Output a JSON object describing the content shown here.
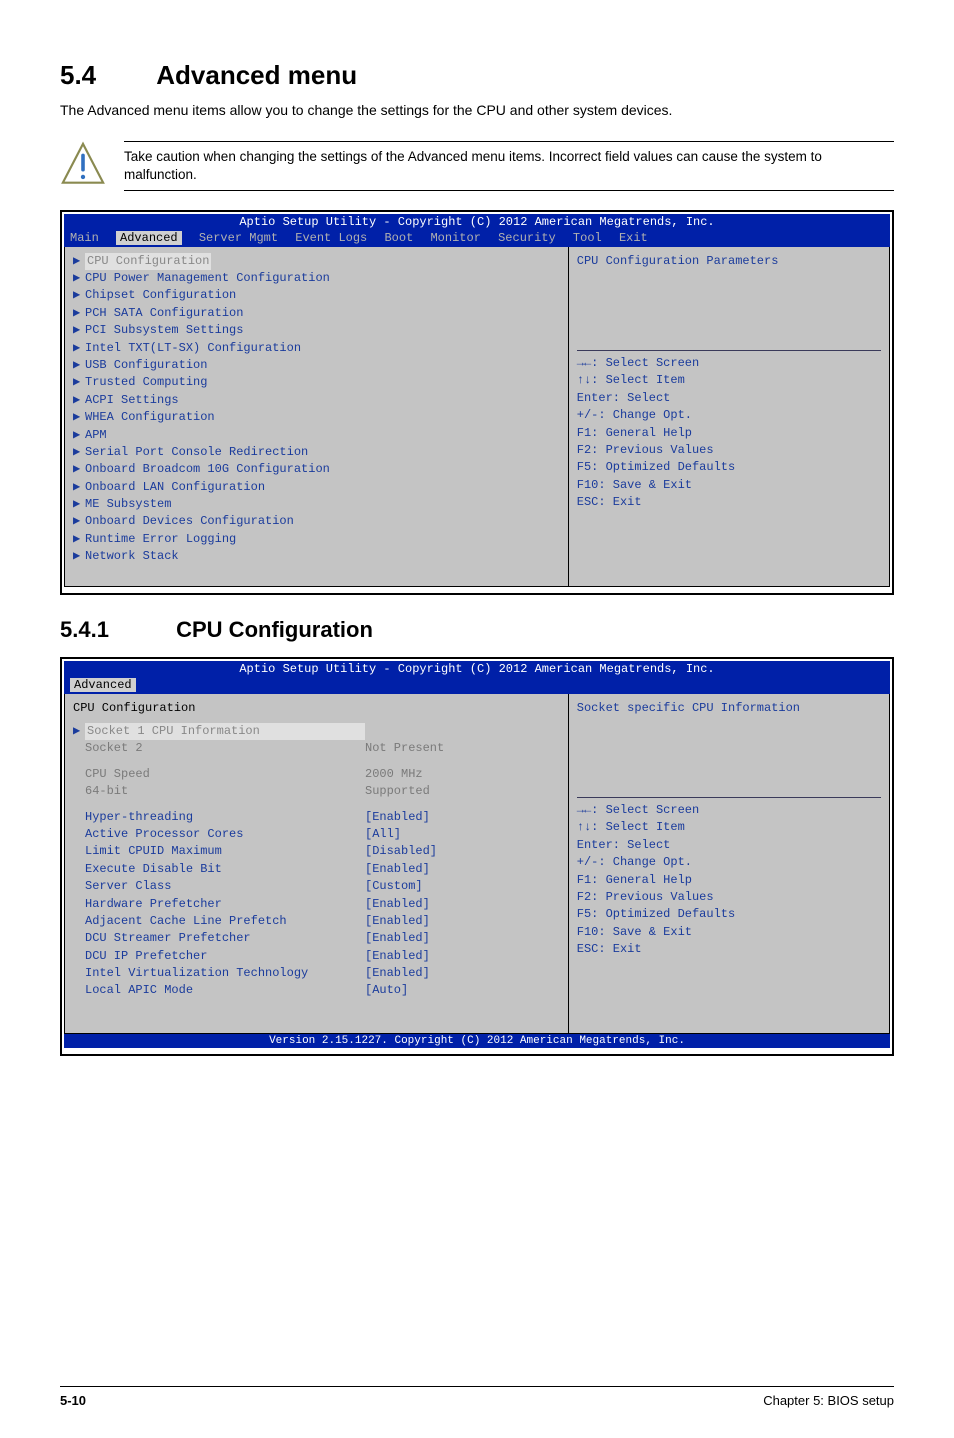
{
  "section": {
    "number": "5.4",
    "title": "Advanced menu",
    "intro": "The Advanced menu items allow you to change the settings for the CPU and other system devices.",
    "note": "Take caution when changing the settings of the Advanced menu items. Incorrect field values can cause the system to malfunction."
  },
  "subsection": {
    "number": "5.4.1",
    "title": "CPU Configuration"
  },
  "bios1": {
    "title": "Aptio Setup Utility - Copyright (C) 2012 American Megatrends, Inc.",
    "tabs": [
      "Main",
      "Advanced",
      "Server Mgmt",
      "Event Logs",
      "Boot",
      "Monitor",
      "Security",
      "Tool",
      "Exit"
    ],
    "active_tab": "Advanced",
    "items": [
      "CPU Configuration",
      "CPU Power Management Configuration",
      "Chipset Configuration",
      "PCH SATA Configuration",
      "PCI Subsystem Settings",
      "Intel TXT(LT-SX) Configuration",
      "USB Configuration",
      "Trusted Computing",
      "ACPI Settings",
      "WHEA Configuration",
      "APM",
      "Serial Port Console Redirection",
      "Onboard Broadcom 10G Configuration",
      "Onboard LAN Configuration",
      "ME Subsystem",
      "Onboard Devices Configuration",
      "Runtime Error Logging",
      "Network Stack"
    ],
    "right_header": "CPU Configuration Parameters",
    "keys": [
      "→←: Select Screen",
      "↑↓: Select Item",
      "Enter: Select",
      "+/-: Change Opt.",
      "F1: General Help",
      "F2: Previous Values",
      "F5: Optimized Defaults",
      "F10: Save & Exit",
      "ESC: Exit"
    ]
  },
  "bios2": {
    "title": "Aptio Setup Utility - Copyright (C) 2012 American Megatrends, Inc.",
    "tabs": [
      "Advanced"
    ],
    "header": "CPU Configuration",
    "dim_items": [
      {
        "label": "Socket 1 CPU Information",
        "value": ""
      },
      {
        "label": "Socket 2",
        "value": "Not Present"
      },
      {
        "label": "",
        "value": ""
      },
      {
        "label": "CPU Speed",
        "value": "2000 MHz"
      },
      {
        "label": "64-bit",
        "value": "Supported"
      }
    ],
    "config_items": [
      {
        "label": "Hyper-threading",
        "value": "[Enabled]"
      },
      {
        "label": "Active Processor Cores",
        "value": "[All]"
      },
      {
        "label": "Limit CPUID Maximum",
        "value": "[Disabled]"
      },
      {
        "label": "Execute Disable Bit",
        "value": "[Enabled]"
      },
      {
        "label": "Server Class",
        "value": "[Custom]"
      },
      {
        "label": "Hardware Prefetcher",
        "value": "[Enabled]"
      },
      {
        "label": "Adjacent Cache Line Prefetch",
        "value": "[Enabled]"
      },
      {
        "label": "DCU Streamer Prefetcher",
        "value": "[Enabled]"
      },
      {
        "label": "DCU IP Prefetcher",
        "value": "[Enabled]"
      },
      {
        "label": "Intel Virtualization Technology",
        "value": "[Enabled]"
      },
      {
        "label": "Local APIC Mode",
        "value": "[Auto]"
      }
    ],
    "right_header": "Socket specific CPU Information",
    "keys": [
      "→←: Select Screen",
      "↑↓: Select Item",
      "Enter: Select",
      "+/-: Change Opt.",
      "F1: General Help",
      "F2: Previous Values",
      "F5: Optimized Defaults",
      "F10: Save & Exit",
      "ESC: Exit"
    ],
    "footer": "Version 2.15.1227. Copyright (C) 2012 American Megatrends, Inc."
  },
  "footer": {
    "page": "5-10",
    "chapter": "Chapter 5: BIOS setup"
  }
}
